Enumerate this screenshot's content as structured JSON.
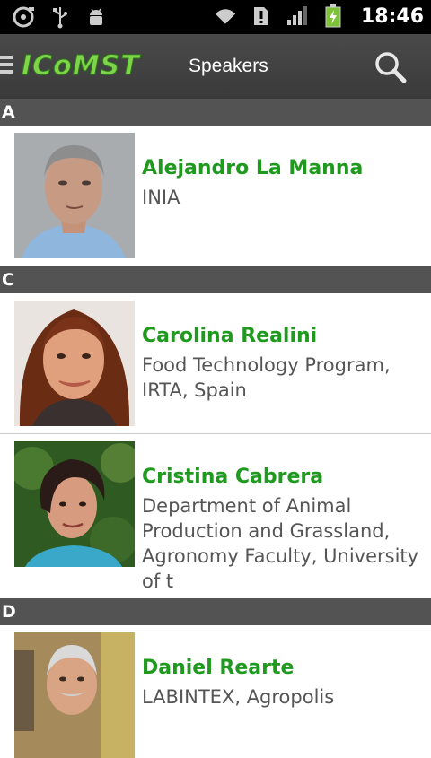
{
  "status_bar": {
    "time": "18:46",
    "icons": [
      "sd-card-icon",
      "usb-icon",
      "android-debug-icon",
      "wifi-icon",
      "alert-icon",
      "signal-icon",
      "battery-charging-icon"
    ]
  },
  "action_bar": {
    "logo_text": "ICoMST",
    "title": "Speakers",
    "search_icon": "search-icon",
    "menu_icon": "menu-icon"
  },
  "sections": [
    {
      "letter": "A",
      "speakers": [
        {
          "name": "Alejandro La Manna",
          "affiliation": "INIA"
        }
      ]
    },
    {
      "letter": "C",
      "speakers": [
        {
          "name": "Carolina Realini",
          "affiliation": "Food Technology Program, IRTA, Spain"
        },
        {
          "name": "Cristina Cabrera",
          "affiliation": "Department of Animal Production and Grassland, Agronomy Faculty, University of t"
        }
      ]
    },
    {
      "letter": "D",
      "speakers": [
        {
          "name": "Daniel Rearte",
          "affiliation": "LABINTEX, Agropolis"
        }
      ]
    }
  ],
  "colors": {
    "name_green": "#1f9a1f",
    "section_header": "#535353",
    "action_bar": "#404040"
  }
}
